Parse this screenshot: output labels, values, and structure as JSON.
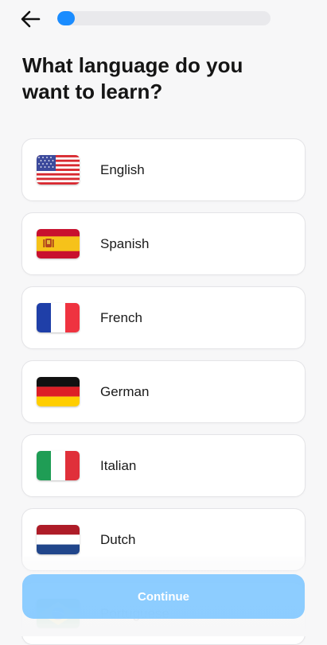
{
  "header": {
    "back_icon": "arrow-left-icon",
    "progress_fraction": 0.05
  },
  "title": "What language do you want to learn?",
  "languages": [
    {
      "label": "English",
      "flag_icon": "us-flag-icon"
    },
    {
      "label": "Spanish",
      "flag_icon": "spain-flag-icon"
    },
    {
      "label": "French",
      "flag_icon": "france-flag-icon"
    },
    {
      "label": "German",
      "flag_icon": "germany-flag-icon"
    },
    {
      "label": "Italian",
      "flag_icon": "italy-flag-icon"
    },
    {
      "label": "Dutch",
      "flag_icon": "netherlands-flag-icon"
    },
    {
      "label": "Portuguese",
      "flag_icon": "brazil-flag-icon"
    }
  ],
  "continue_button": {
    "label": "Continue"
  },
  "colors": {
    "accent": "#1a8cff",
    "button": "#7dc6ff",
    "background": "#f7f7f8"
  }
}
